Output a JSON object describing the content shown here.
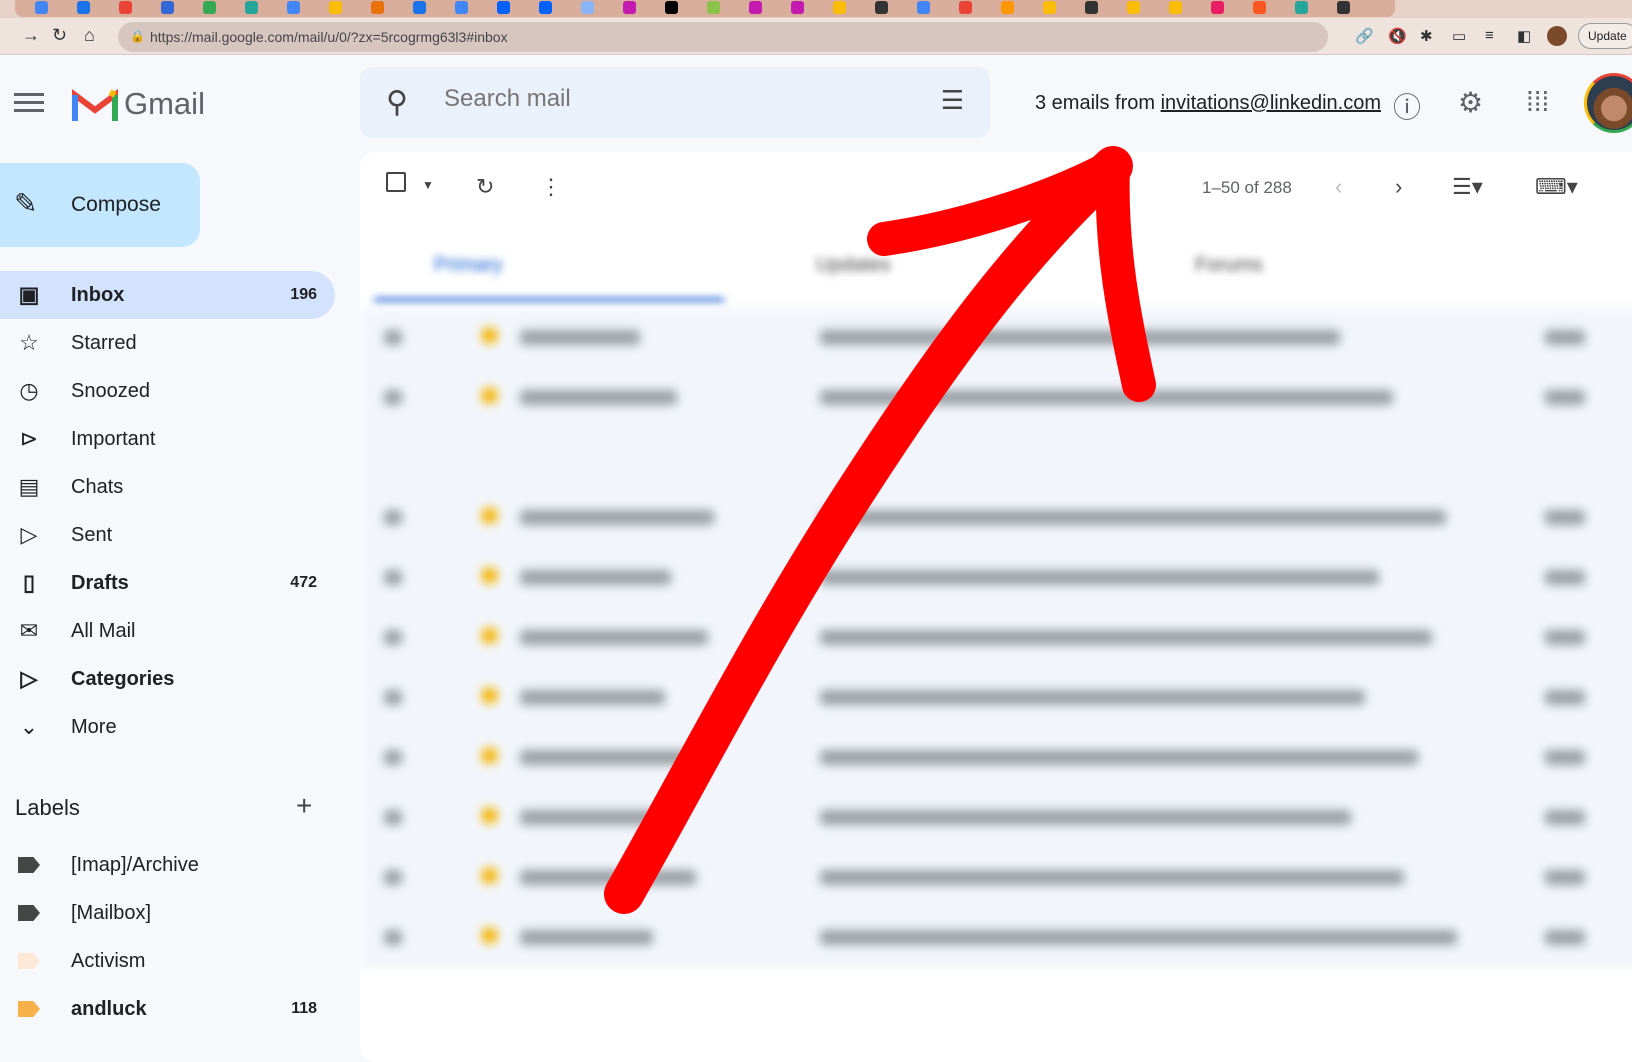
{
  "browser": {
    "url": "https://mail.google.com/mail/u/0/?zx=5rcogrmg63l3#inbox",
    "update_label": "Update"
  },
  "app": {
    "name": "Gmail"
  },
  "search": {
    "placeholder": "Search mail"
  },
  "header": {
    "filter_prefix": "3 emails from",
    "filter_email": "invitations@linkedin.com"
  },
  "compose_label": "Compose",
  "nav": [
    {
      "label": "Inbox",
      "count": "196",
      "icon": "inbox-icon"
    },
    {
      "label": "Starred",
      "count": "",
      "icon": "star-icon"
    },
    {
      "label": "Snoozed",
      "count": "",
      "icon": "clock-icon"
    },
    {
      "label": "Important",
      "count": "",
      "icon": "important-icon"
    },
    {
      "label": "Chats",
      "count": "",
      "icon": "chat-icon"
    },
    {
      "label": "Sent",
      "count": "",
      "icon": "send-icon"
    },
    {
      "label": "Drafts",
      "count": "472",
      "icon": "draft-icon"
    },
    {
      "label": "All Mail",
      "count": "",
      "icon": "all-mail-icon"
    },
    {
      "label": "Categories",
      "count": "",
      "icon": "label-icon"
    },
    {
      "label": "More",
      "count": "",
      "icon": "chevron-down-icon"
    }
  ],
  "labels": {
    "title": "Labels",
    "items": [
      {
        "label": "[Imap]/Archive",
        "count": "",
        "color": "#444746"
      },
      {
        "label": "[Mailbox]",
        "count": "",
        "color": "#444746"
      },
      {
        "label": "Activism",
        "count": "",
        "color": "#fde7d6"
      },
      {
        "label": "andluck",
        "count": "118",
        "color": "#f6b14a"
      }
    ]
  },
  "toolbar": {
    "pager": "1–50 of 288"
  },
  "mail_tabs": [
    "Primary",
    "Updates",
    "Forums"
  ],
  "annotation": {
    "color": "#ff0000"
  }
}
